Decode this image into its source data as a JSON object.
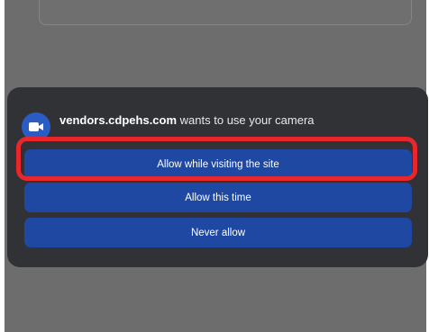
{
  "dialog": {
    "site": "vendors.cdpehs.com",
    "message": "wants to use your camera",
    "icon": "video-camera-icon"
  },
  "buttons": {
    "allow_site": "Allow while visiting the site",
    "allow_once": "Allow this time",
    "never": "Never allow"
  },
  "colors": {
    "dialog_bg": "#303236",
    "button_bg": "#1e48a2",
    "icon_badge": "#2b5cc4",
    "highlight": "#e8262c",
    "scrim": "#6d6d6d"
  }
}
